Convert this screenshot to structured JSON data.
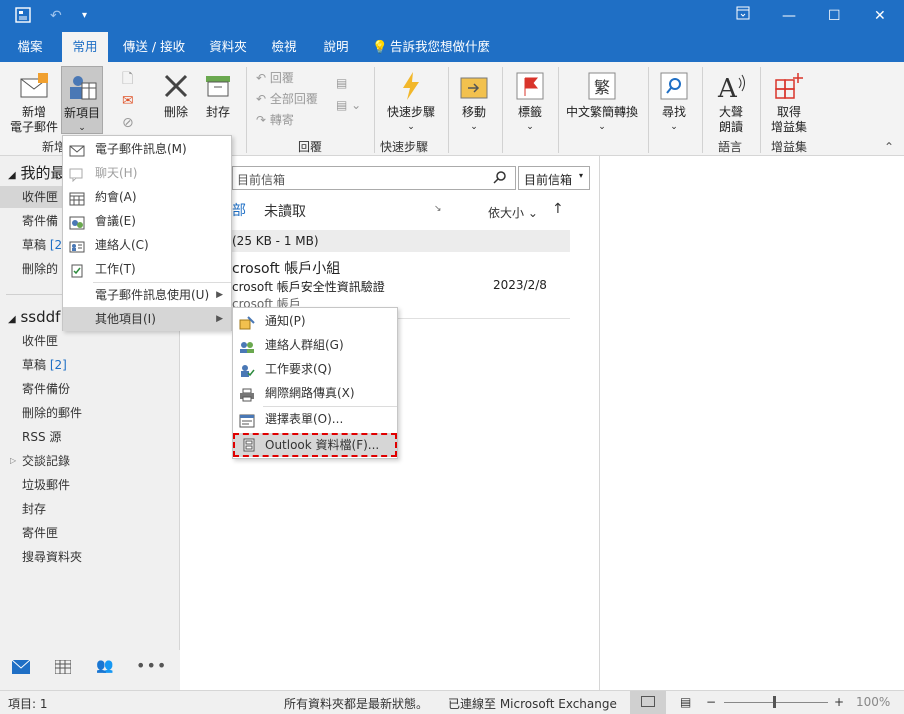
{
  "titlebar": {
    "qat_save_icon": "save-icon",
    "undo_icon": "undo-icon",
    "minimize": "—",
    "restore": "⧉",
    "maximize": "☐",
    "close": "✕"
  },
  "tabs": [
    {
      "label": "檔案",
      "active": false
    },
    {
      "label": "常用",
      "active": true
    },
    {
      "label": "傳送 / 接收",
      "active": false
    },
    {
      "label": "資料夾",
      "active": false
    },
    {
      "label": "檢視",
      "active": false
    },
    {
      "label": "說明",
      "active": false
    }
  ],
  "tell_me": "告訴我您想做什麼",
  "ribbon": {
    "new_email": "新增\n電子郵件",
    "new_email_l1": "新增",
    "new_email_l2": "電子郵件",
    "new_items": "新項目",
    "group_new": "新增",
    "delete": "刪除",
    "archive": "封存",
    "reply": "回覆",
    "reply_all": "全部回覆",
    "forward": "轉寄",
    "group_respond": "回覆",
    "quick_steps": "快速步驟",
    "group_quick": "快速步驟",
    "move": "移動",
    "tags": "標籤",
    "convert": "中文繁簡轉換",
    "find": "尋找",
    "read_aloud_l1": "大聲",
    "read_aloud_l2": "朗讀",
    "group_speech": "語言",
    "get_addins_l1": "取得",
    "get_addins_l2": "增益集",
    "group_addins": "增益集"
  },
  "left_pane": {
    "account1": "我的最",
    "folders1": [
      {
        "label": "收件匣",
        "count": ""
      },
      {
        "label": "寄件備",
        "count": ""
      },
      {
        "label": "草稿",
        "count": "[2"
      },
      {
        "label": "刪除的",
        "count": ""
      }
    ],
    "account2": "ssddf",
    "folders2": [
      {
        "label": "收件匣",
        "count": ""
      },
      {
        "label": "草稿",
        "count": "[2]"
      },
      {
        "label": "寄件備份",
        "count": ""
      },
      {
        "label": "刪除的郵件",
        "count": ""
      },
      {
        "label": "RSS 源",
        "count": ""
      },
      {
        "label": "交談記錄",
        "count": ""
      },
      {
        "label": "垃圾郵件",
        "count": ""
      },
      {
        "label": "封存",
        "count": ""
      },
      {
        "label": "寄件匣",
        "count": ""
      },
      {
        "label": "搜尋資料夾",
        "count": ""
      }
    ]
  },
  "mail_list": {
    "search_placeholder": "目前信箱",
    "scope": "目前信箱",
    "tab_all": "部",
    "tab_unread": "未讀取",
    "sort": "依大小",
    "group_header": "(25 KB - 1 MB)",
    "item_sender": "crosoft 帳戶小組",
    "item_subject": "crosoft 帳戶安全性資訊驗證",
    "item_preview": "crosoft 帳戶",
    "item_date": "2023/2/8"
  },
  "menu_new_items": [
    {
      "label": "電子郵件訊息(M)",
      "icon": "mail-icon",
      "disabled": false
    },
    {
      "label": "聊天(H)",
      "icon": "chat-icon",
      "disabled": true
    },
    {
      "label": "約會(A)",
      "icon": "calendar-icon",
      "disabled": false
    },
    {
      "label": "會議(E)",
      "icon": "meeting-icon",
      "disabled": false
    },
    {
      "label": "連絡人(C)",
      "icon": "contact-icon",
      "disabled": false
    },
    {
      "label": "工作(T)",
      "icon": "task-icon",
      "disabled": false
    },
    {
      "label": "電子郵件訊息使用(U)",
      "icon": "",
      "disabled": false
    },
    {
      "label": "其他項目(I)",
      "icon": "",
      "disabled": false
    }
  ],
  "menu_more_items": [
    {
      "label": "通知(P)",
      "icon": "post-icon"
    },
    {
      "label": "連絡人群組(G)",
      "icon": "contact-group-icon"
    },
    {
      "label": "工作要求(Q)",
      "icon": "task-request-icon"
    },
    {
      "label": "網際網路傳真(X)",
      "icon": "fax-icon"
    },
    {
      "label": "選擇表單(O)...",
      "icon": "form-icon"
    },
    {
      "label": "Outlook 資料檔(F)...",
      "icon": "data-file-icon"
    }
  ],
  "status": {
    "items": "項目: 1",
    "sync": "所有資料夾都是最新狀態。",
    "connected": "已連線至 Microsoft Exchange",
    "zoom": "100%"
  },
  "colors": {
    "accent": "#1f6fc5",
    "highlight_border": "#e00000"
  }
}
